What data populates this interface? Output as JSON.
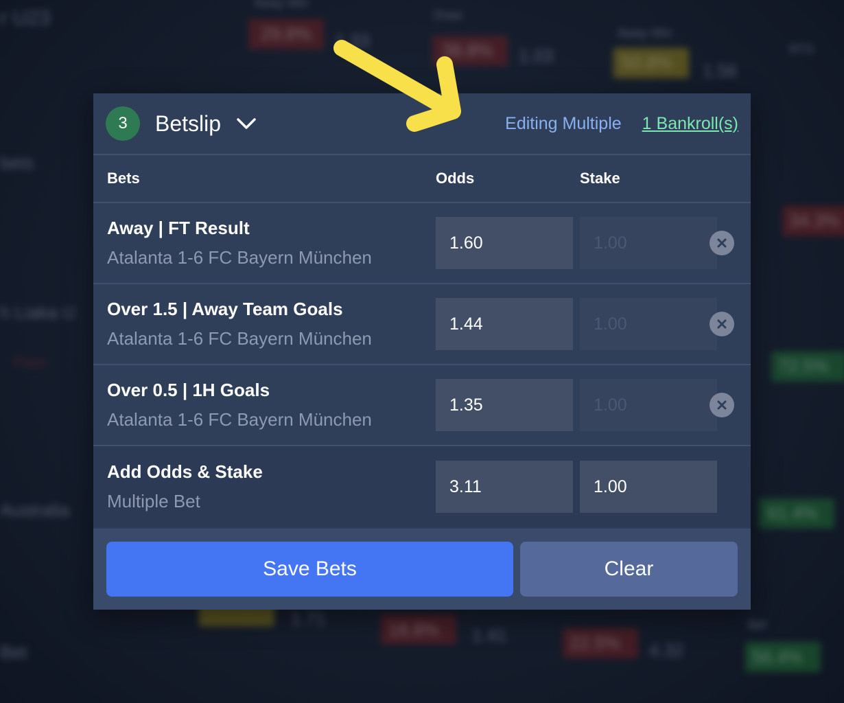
{
  "background": {
    "texts": [
      "r U23",
      "Away Win",
      "Draw",
      "Away Win",
      "bets",
      "RTS",
      "h Liaka U",
      "Australia",
      "Bet",
      "Pass",
      "Bet"
    ],
    "values": [
      "29.8%",
      "1.33",
      "38.8%",
      "1.03",
      "50.8%",
      "1.56",
      "34.3%",
      "72.5%",
      "61.4%",
      "1.71",
      "18.8%",
      "1.41",
      "22.5%",
      "4.32",
      "56.4%"
    ]
  },
  "betslip": {
    "count": "3",
    "title": "Betslip",
    "editing_label": "Editing Multiple",
    "bankroll_label": "1 Bankroll(s)",
    "columns": {
      "bets": "Bets",
      "odds": "Odds",
      "stake": "Stake"
    },
    "bets": [
      {
        "market": "Away | FT Result",
        "match": "Atalanta 1-6 FC Bayern München",
        "odds": "1.60",
        "stake": "1.00"
      },
      {
        "market": "Over 1.5 | Away Team Goals",
        "match": "Atalanta 1-6 FC Bayern München",
        "odds": "1.44",
        "stake": "1.00"
      },
      {
        "market": "Over 0.5 | 1H Goals",
        "match": "Atalanta 1-6 FC Bayern München",
        "odds": "1.35",
        "stake": "1.00"
      }
    ],
    "total": {
      "label": "Add Odds & Stake",
      "sublabel": "Multiple Bet",
      "odds": "3.11",
      "stake": "1.00"
    },
    "save_label": "Save Bets",
    "clear_label": "Clear"
  },
  "colors": {
    "accent_blue": "#4475f2",
    "count_badge": "#2e7a52",
    "bankroll_link": "#7ce7b0",
    "arrow": "#f7e04a"
  }
}
